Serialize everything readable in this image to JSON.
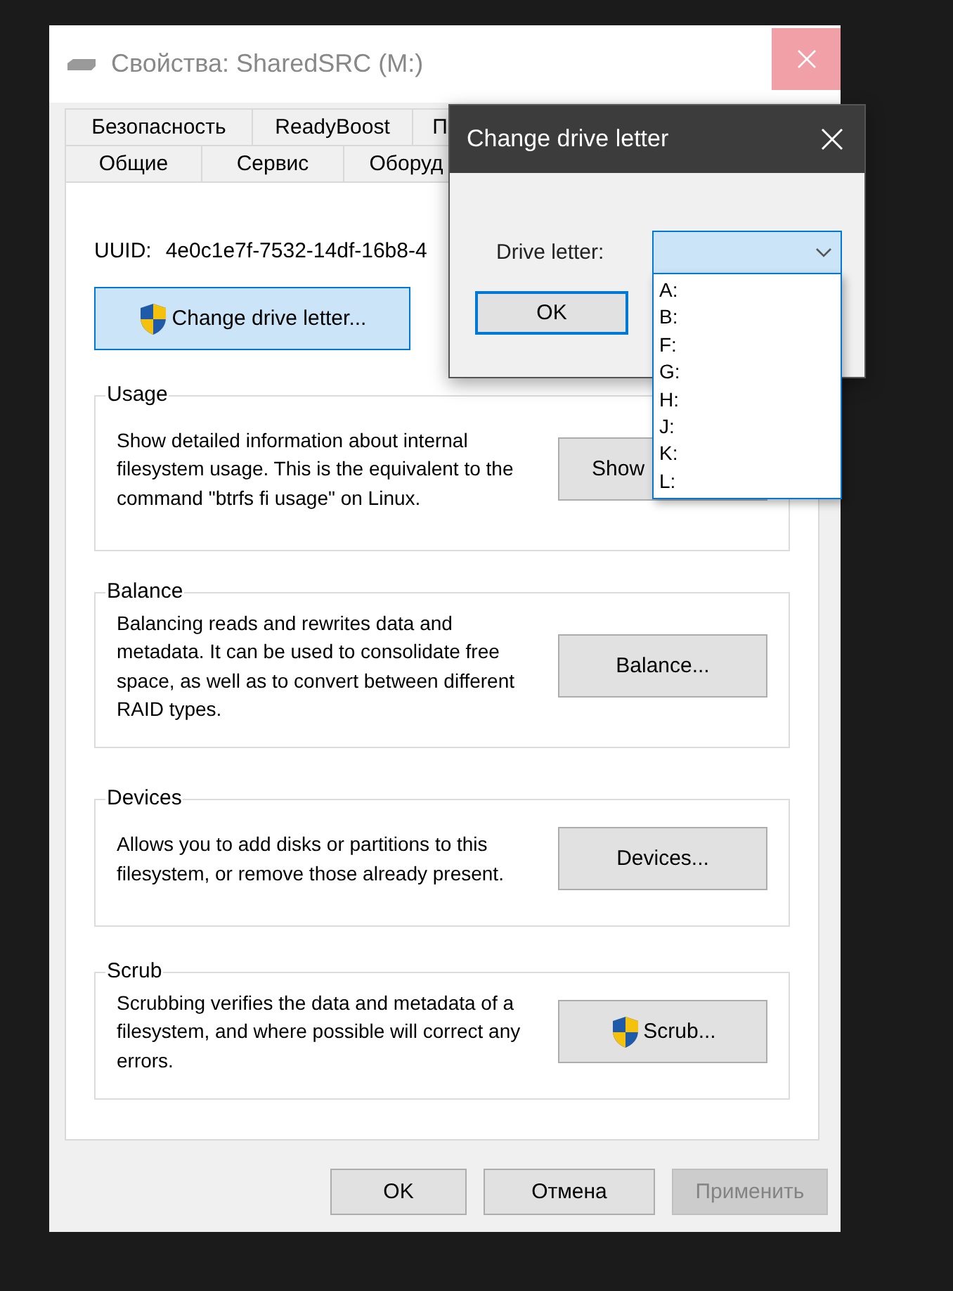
{
  "window": {
    "title": "Свойства: SharedSRC (M:)"
  },
  "tabs_row_1": [
    {
      "label": "Безопасность",
      "selected": false
    },
    {
      "label": "ReadyBoost",
      "selected": false
    },
    {
      "label": "П",
      "selected": false
    }
  ],
  "tabs_row_2": [
    {
      "label": "Общие",
      "selected": false
    },
    {
      "label": "Сервис",
      "selected": false
    },
    {
      "label": "Оборуд",
      "selected": false
    }
  ],
  "uuid": {
    "label": "UUID:",
    "value": "4e0c1e7f-7532-14df-16b8-4"
  },
  "change_drive_letter_button": "Change drive letter...",
  "groups": [
    {
      "title": "Usage",
      "text": "Show detailed information about internal filesystem usage. This is the equivalent to the command \"btrfs fi usage\" on Linux.",
      "button": "Show",
      "shield": false
    },
    {
      "title": "Balance",
      "text": "Balancing reads and rewrites data and metadata. It can be used to consolidate free space, as well as to convert between different RAID types.",
      "button": "Balance...",
      "shield": false
    },
    {
      "title": "Devices",
      "text": "Allows you to add disks or partitions to this filesystem, or remove those already present.",
      "button": "Devices...",
      "shield": false
    },
    {
      "title": "Scrub",
      "text": "Scrubbing verifies the data and metadata of a filesystem, and where possible will correct any errors.",
      "button": "Scrub...",
      "shield": true
    }
  ],
  "buttons": [
    {
      "label": "OK",
      "disabled": false
    },
    {
      "label": "Отмена",
      "disabled": false
    },
    {
      "label": "Применить",
      "disabled": true
    }
  ],
  "dialog": {
    "title": "Change drive letter",
    "field_label": "Drive letter:",
    "ok_button": "OK",
    "options": [
      {
        "label": "A:",
        "selected": false
      },
      {
        "label": "B:",
        "selected": false
      },
      {
        "label": "F:",
        "selected": false
      },
      {
        "label": "G:",
        "selected": false
      },
      {
        "label": "H:",
        "selected": false
      },
      {
        "label": "J:",
        "selected": false
      },
      {
        "label": "K:",
        "selected": false
      },
      {
        "label": "L:",
        "selected": false
      }
    ]
  }
}
